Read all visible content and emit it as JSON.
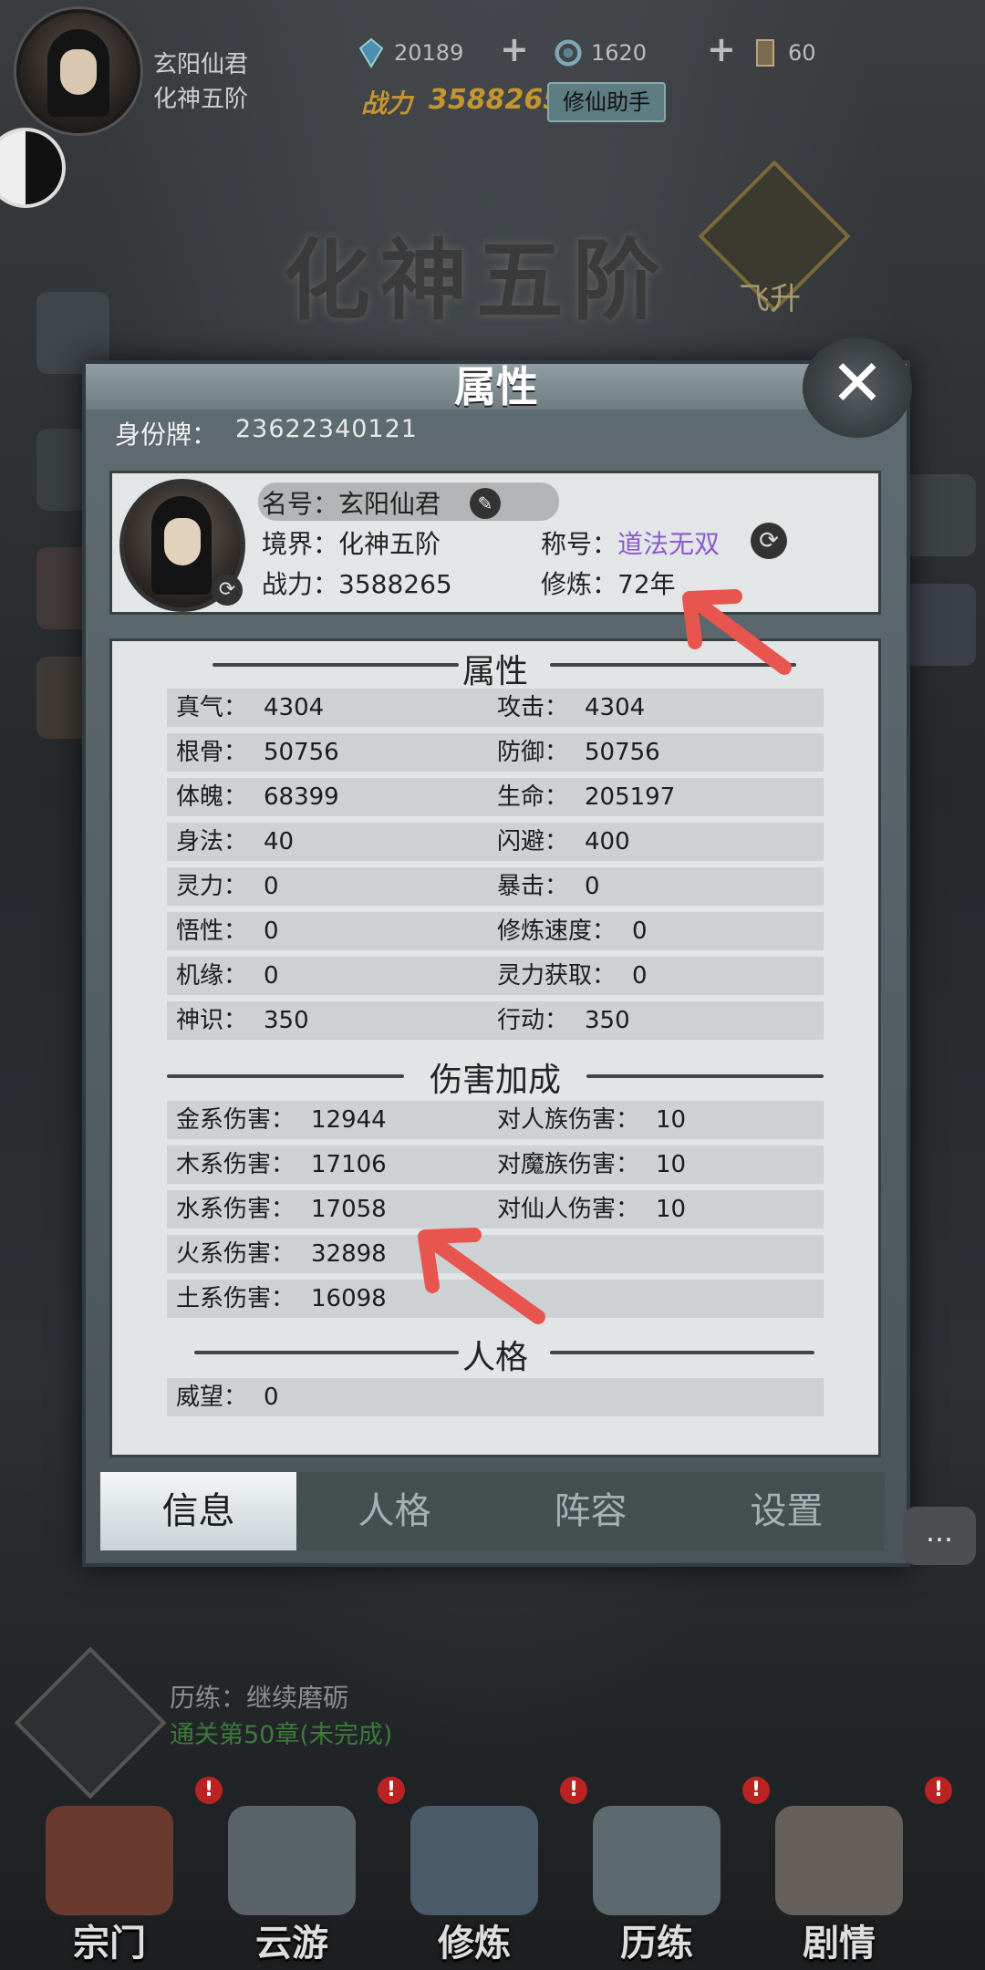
{
  "player": {
    "name": "玄阳仙君",
    "realm": "化神五阶"
  },
  "resources": [
    {
      "icon": "crystal-icon",
      "value": "20189"
    },
    {
      "icon": "spirit-stone-icon",
      "value": "1620"
    },
    {
      "icon": "scroll-icon",
      "value": "60"
    }
  ],
  "combat": {
    "label": "战力",
    "value": "3588265"
  },
  "assist_button": "修仙助手",
  "realm_banner": "化神五阶",
  "ascend_label": "飞升",
  "modal": {
    "title": "属性",
    "id_label": "身份牌：",
    "id_value": "23622340121",
    "card": {
      "name_label": "名号：",
      "name_value": "玄阳仙君",
      "realm_label": "境界：",
      "realm_value": "化神五阶",
      "title_label": "称号：",
      "title_value": "道法无双",
      "power_label": "战力：",
      "power_value": "3588265",
      "cultivate_label": "修炼：",
      "cultivate_value": "72年"
    },
    "sections": {
      "attributes": "属性",
      "damage": "伤害加成",
      "personality": "人格"
    },
    "attributes": [
      {
        "l1": "真气：",
        "v1": "4304",
        "l2": "攻击：",
        "v2": "4304"
      },
      {
        "l1": "根骨：",
        "v1": "50756",
        "l2": "防御：",
        "v2": "50756"
      },
      {
        "l1": "体魄：",
        "v1": "68399",
        "l2": "生命：",
        "v2": "205197"
      },
      {
        "l1": "身法：",
        "v1": "40",
        "l2": "闪避：",
        "v2": "400"
      },
      {
        "l1": "灵力：",
        "v1": "0",
        "l2": "暴击：",
        "v2": "0"
      },
      {
        "l1": "悟性：",
        "v1": "0",
        "l2": "修炼速度：",
        "v2": "0"
      },
      {
        "l1": "机缘：",
        "v1": "0",
        "l2": "灵力获取：",
        "v2": "0"
      },
      {
        "l1": "神识：",
        "v1": "350",
        "l2": "行动：",
        "v2": "350"
      }
    ],
    "damage": [
      {
        "l1": "金系伤害：",
        "v1": "12944",
        "l2": "对人族伤害：",
        "v2": "10"
      },
      {
        "l1": "木系伤害：",
        "v1": "17106",
        "l2": "对魔族伤害：",
        "v2": "10"
      },
      {
        "l1": "水系伤害：",
        "v1": "17058",
        "l2": "对仙人伤害：",
        "v2": "10"
      },
      {
        "l1": "火系伤害：",
        "v1": "32898",
        "l2": "",
        "v2": ""
      },
      {
        "l1": "土系伤害：",
        "v1": "16098",
        "l2": "",
        "v2": ""
      }
    ],
    "personality": [
      {
        "l1": "威望：",
        "v1": "0"
      }
    ],
    "tabs": [
      "信息",
      "人格",
      "阵容",
      "设置"
    ],
    "active_tab": 0
  },
  "trial": {
    "label": "历练：继续磨砺",
    "progress": "通关第50章(未完成)"
  },
  "bottom_nav": [
    {
      "label": "宗门",
      "alert": "!"
    },
    {
      "label": "云游",
      "alert": "!"
    },
    {
      "label": "修炼",
      "alert": "!"
    },
    {
      "label": "历练",
      "alert": "!"
    },
    {
      "label": "剧情",
      "alert": "!"
    }
  ],
  "colors": {
    "accent_gold": "#c3962f",
    "title_purple": "#8b5bd0",
    "annotation_red": "#e8554e",
    "progress_green": "#3c7a3a"
  }
}
